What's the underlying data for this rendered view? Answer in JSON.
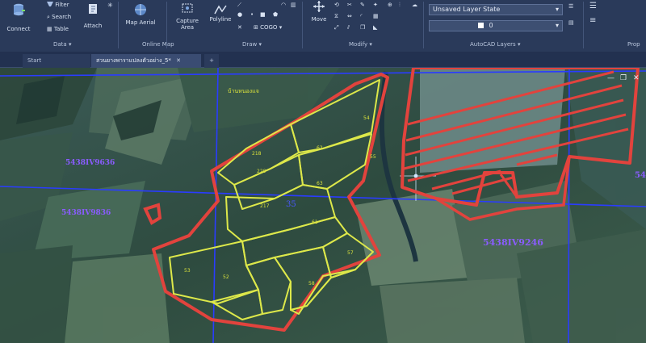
{
  "ribbon": {
    "connect": "Connect",
    "filter": "Filter",
    "search": "Search",
    "table": "Table",
    "attach": "Attach",
    "map_aerial": "Map Aerial",
    "capture_area": "Capture\nArea",
    "polyline": "Polyline",
    "cogo": "COGO",
    "move": "Move",
    "layer_state": "Unsaved Layer State",
    "layer_current": "0",
    "panels": {
      "data": "Data",
      "online_map": "Online Map",
      "draw": "Draw",
      "modify": "Modify",
      "autocad_layers": "AutoCAD Layers",
      "properties": "Prop"
    }
  },
  "tabs": {
    "start": "Start",
    "active": "สวนยางพาราแปลงตัวอย่าง_5*",
    "add": "+"
  },
  "map": {
    "place_label": "บ้านหนองแจ",
    "grid_labels": [
      "5438IV9636",
      "5438IV9836",
      "5438IV9246",
      "54"
    ],
    "sheet_number": "35",
    "parcel_labels": [
      "54",
      "218",
      "220",
      "62",
      "63",
      "217",
      "61",
      "55",
      "53",
      "57",
      "52",
      "58"
    ]
  },
  "colors": {
    "parcel_outline": "#e2433d",
    "plot_outline": "#dde84a",
    "grid_line": "#2a3cff",
    "grid_label": "#8a5cff"
  }
}
